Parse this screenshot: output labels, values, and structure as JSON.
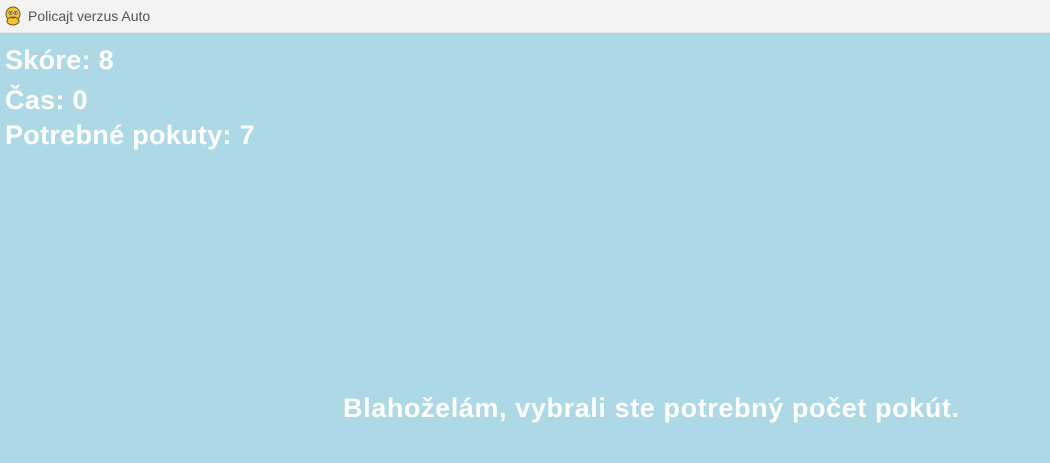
{
  "window": {
    "title": "Policajt verzus Auto",
    "icon": "pygame-snake-icon"
  },
  "hud": {
    "score": "Skóre: 8",
    "time": "Čas: 0",
    "required_fines": "Potrebné pokuty: 7"
  },
  "message": "Blahoželám, vybrali ste potrebný počet pokút.",
  "colors": {
    "background": "#add8e6",
    "text": "#ffffff",
    "titlebar": "#f3f3f3"
  }
}
